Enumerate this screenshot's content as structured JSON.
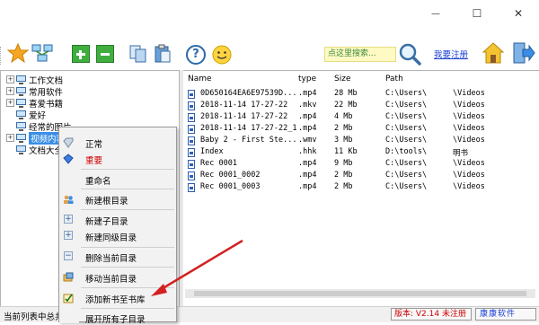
{
  "window": {
    "minimize_glyph": "—",
    "maximize_glyph": "☐",
    "close_glyph": "✕"
  },
  "toolbar": {
    "search_placeholder": "点这里搜索...",
    "register_label": "我要注册",
    "help_glyph": "?",
    "icons": [
      "star-icon",
      "network-icon",
      "add-icon",
      "remove-icon",
      "copy-icon",
      "paste-icon",
      "help-icon",
      "smiley-icon",
      "search-icon",
      "home-icon",
      "exit-icon"
    ]
  },
  "tree": {
    "items": [
      {
        "label": "工作文档",
        "expander": "+"
      },
      {
        "label": "常用软件",
        "expander": "+"
      },
      {
        "label": "喜爱书籍",
        "expander": "+"
      },
      {
        "label": "爱好",
        "expander": ""
      },
      {
        "label": "经常的图片",
        "expander": ""
      },
      {
        "label": "视频内容",
        "expander": "+",
        "selected": true
      },
      {
        "label": "文档大全",
        "expander": ""
      }
    ]
  },
  "list": {
    "columns": {
      "name": "Name",
      "type": "type",
      "size": "Size",
      "path": "Path"
    },
    "rows": [
      {
        "name": "0D650164EA6E97539D...",
        "type": ".mp4",
        "size": "28 Mb",
        "path": "C:\\Users\\",
        "path2": "\\Videos"
      },
      {
        "name": "2018-11-14 17-27-22",
        "type": ".mkv",
        "size": "22 Mb",
        "path": "C:\\Users\\",
        "path2": "\\Videos"
      },
      {
        "name": "2018-11-14 17-27-22",
        "type": ".mp4",
        "size": "4 Mb",
        "path": "C:\\Users\\",
        "path2": "\\Videos"
      },
      {
        "name": "2018-11-14 17-27-22_1",
        "type": ".mp4",
        "size": "2 Mb",
        "path": "C:\\Users\\",
        "path2": "\\Videos"
      },
      {
        "name": "Baby 2 - First Ste...",
        "type": ".wmv",
        "size": "3 Mb",
        "path": "C:\\Users\\",
        "path2": "\\Videos"
      },
      {
        "name": "Index",
        "type": ".hhk",
        "size": "11 Kb",
        "path": "D:\\tools\\",
        "path2": "明书"
      },
      {
        "name": "Rec 0001",
        "type": ".mp4",
        "size": "9 Mb",
        "path": "C:\\Users\\",
        "path2": "\\Videos"
      },
      {
        "name": "Rec 0001_0002",
        "type": ".mp4",
        "size": "2 Mb",
        "path": "C:\\Users\\",
        "path2": "\\Videos"
      },
      {
        "name": "Rec 0001_0003",
        "type": ".mp4",
        "size": "2 Mb",
        "path": "C:\\Users\\",
        "path2": "\\Videos"
      }
    ]
  },
  "context_menu": {
    "items": [
      {
        "label": "正常",
        "icon": "normal-icon"
      },
      {
        "label": "重要",
        "icon": "important-icon",
        "color": "#d00000"
      },
      {
        "label": "重命名",
        "icon": ""
      },
      {
        "label": "新建根目录",
        "icon": "users-icon"
      },
      {
        "label": "新建子目录",
        "icon": "plus-icon"
      },
      {
        "label": "新建同级目录",
        "icon": "plus-icon"
      },
      {
        "label": "删除当前目录",
        "icon": "minus-icon"
      },
      {
        "label": "移动当前目录",
        "icon": "move-icon"
      },
      {
        "label": "添加新书至书库",
        "icon": "check-icon"
      },
      {
        "label": "展开所有子目录",
        "icon": ""
      }
    ]
  },
  "status": {
    "left_text": "当前列表中总共",
    "version_text": "版本: V2.14 未注册",
    "brand_text": "康康软件"
  },
  "colors": {
    "selection": "#3a8ee6",
    "important": "#d00000",
    "arrow": "#d42020",
    "link": "#1a3fd6"
  }
}
